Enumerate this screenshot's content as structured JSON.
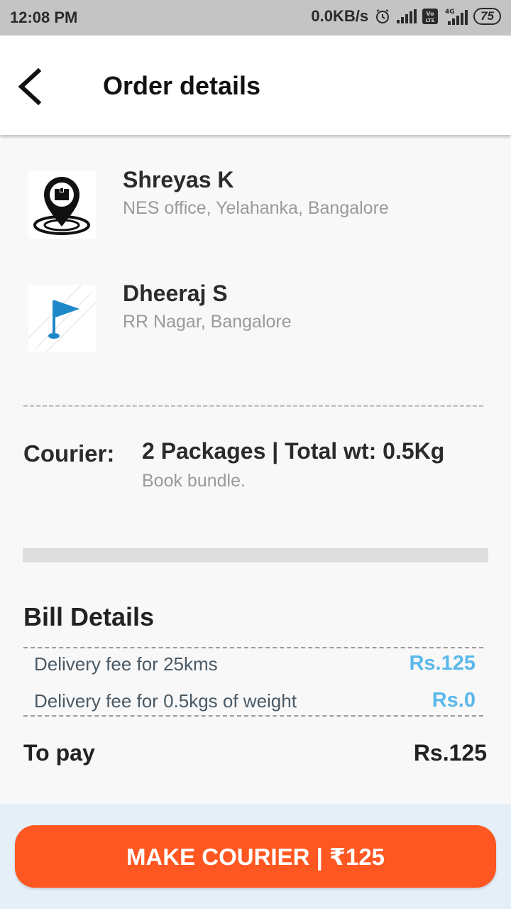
{
  "status_bar": {
    "time": "12:08 PM",
    "network_speed": "0.0KB/s",
    "volte_label": "Vo LTE",
    "network_type": "4G",
    "battery": "75",
    "icons": [
      "alarm-icon",
      "signal-icon",
      "volte-icon",
      "signal-4g-icon",
      "battery-icon"
    ]
  },
  "header": {
    "title": "Order details",
    "back_icon": "back-arrow-icon"
  },
  "pickup": {
    "name": "Shreyas K",
    "address": "NES office, Yelahanka, Bangalore",
    "icon": "location-pin-icon"
  },
  "drop": {
    "name": "Dheeraj S",
    "address": "RR Nagar, Bangalore",
    "icon": "flag-icon"
  },
  "courier": {
    "label": "Courier:",
    "info": "2 Packages | Total wt: 0.5Kg",
    "description": "Book bundle."
  },
  "bill": {
    "title": "Bill Details",
    "items": [
      {
        "label": "Delivery fee for 25kms",
        "amount": "Rs.125"
      },
      {
        "label": "Delivery fee for 0.5kgs of weight",
        "amount": "Rs.0"
      }
    ],
    "to_pay_label": "To pay",
    "to_pay_amount": "Rs.125"
  },
  "cta": {
    "label": "MAKE COURIER | ₹125"
  },
  "colors": {
    "accent": "#ff5722",
    "amount_blue": "#5ab8ea",
    "flag_blue": "#1e88c9",
    "footer_bg": "#e4eff8"
  }
}
